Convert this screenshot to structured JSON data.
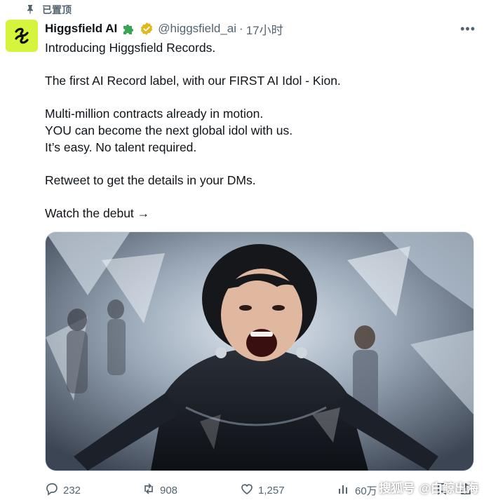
{
  "pinned_label": "已置顶",
  "author": {
    "name": "Higgsfield AI",
    "handle": "@higgsfield_ai",
    "time": "17小时"
  },
  "tweet": {
    "line1": "Introducing Higgsfield Records.",
    "line2": "The first AI Record label, with our FIRST AI Idol - Kion.",
    "line3": "Multi-million contracts already in motion.",
    "line4": "YOU can become the next global idol with us.",
    "line5": "It’s easy. No talent required.",
    "line6": "Retweet to get the details in your DMs.",
    "line7": "Watch the debut →"
  },
  "stats": {
    "replies": "232",
    "retweets": "908",
    "likes": "1,257",
    "views": "60万"
  },
  "watermark": {
    "prefix": "搜狐号",
    "source": "@白鲸出海"
  },
  "icons": [
    "pin-icon",
    "puzzle-icon",
    "verified-badge-icon",
    "more-icon",
    "reply-icon",
    "retweet-icon",
    "like-icon",
    "views-icon",
    "bookmark-icon",
    "share-icon"
  ],
  "colors": {
    "avatar_bg": "#d4f53c",
    "verified_gold": "#e2b719",
    "puzzle_green": "#3aa655",
    "muted_text": "#536471"
  }
}
